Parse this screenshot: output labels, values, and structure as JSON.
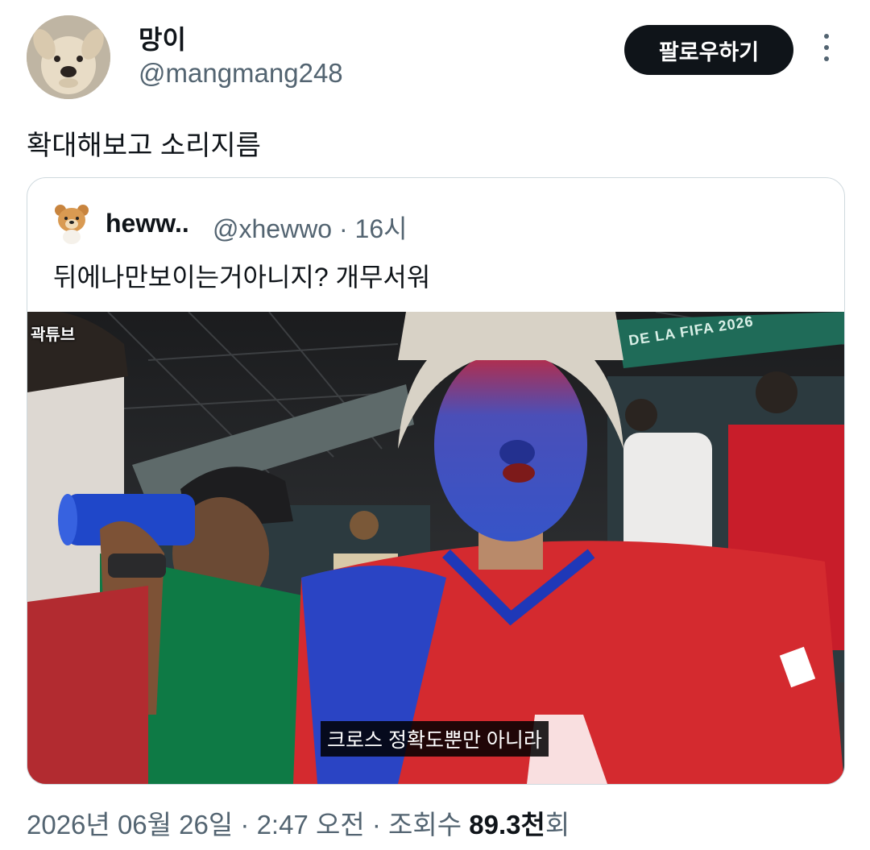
{
  "author": {
    "display_name": "망이",
    "handle": "@mangmang248",
    "avatar_icon": "dog-avatar-icon"
  },
  "follow_button": "팔로우하기",
  "more_icon": "more-vertical-icon",
  "tweet_text": "확대해보고 소리지름",
  "quoted": {
    "display_name": "heww..",
    "handle_time": "@xhewwo · 16시",
    "text": "뒤에나만보이는거아니지?  개무서워",
    "avatar_icon": "bear-avatar-icon",
    "media": {
      "watermark": "곽튜브",
      "subtitle": "크로스 정확도뿐만 아니라",
      "stadium_sign": "DE LA FIFA 2026"
    }
  },
  "meta": {
    "date": "2026년 06월 26일 · 2:47 오전 · 조회수 ",
    "views": "89.3천",
    "views_suffix": "회"
  },
  "colors": {
    "follow_bg": "#0f1419",
    "secondary_text": "#536471",
    "border": "#cfd9de"
  }
}
